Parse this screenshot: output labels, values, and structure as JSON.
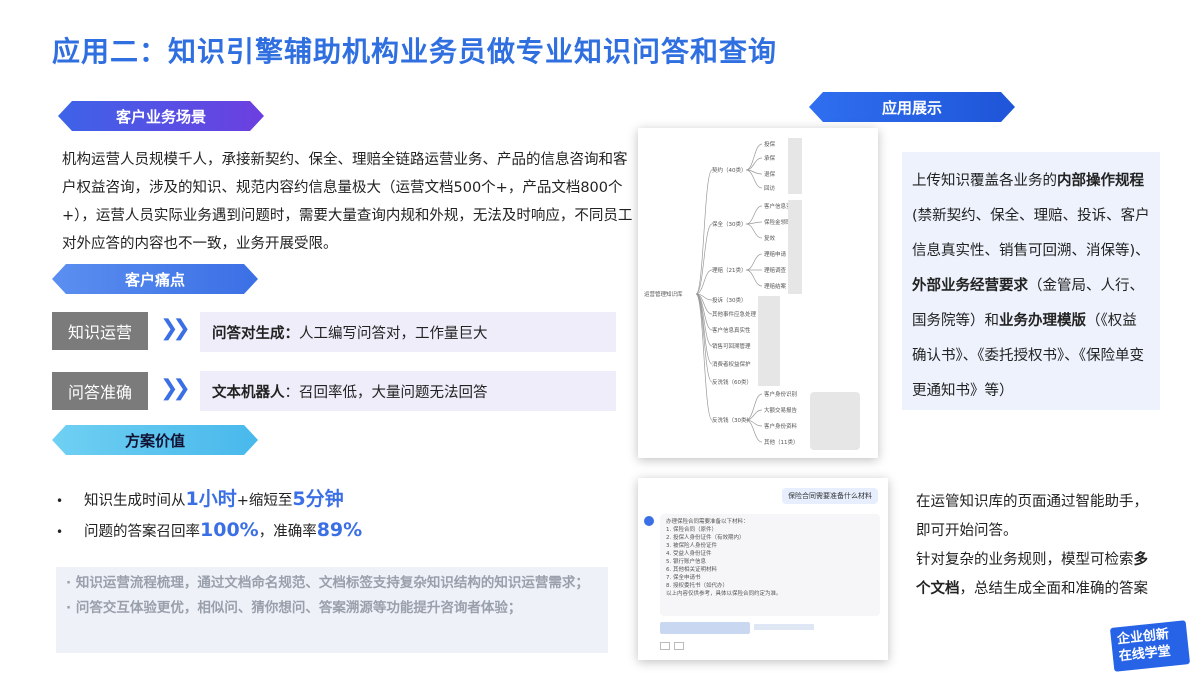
{
  "title": "应用二：知识引擎辅助机构业务员做专业知识问答和查询",
  "sections": {
    "scene": "客户业务场景",
    "pain": "客户痛点",
    "value": "方案价值",
    "show": "应用展示"
  },
  "scene_text": "机构运营人员规模千人，承接新契约、保全、理赔全链路运营业务、产品的信息咨询和客户权益咨询，涉及的知识、规范内容约信息量极大（运营文档500个+，产品文档800个+），运营人员实际业务遇到问题时，需要大量查询内规和外规，无法及时响应，不同员工对外应答的内容也不一致，业务开展受限。",
  "pains": [
    {
      "tag": "知识运营",
      "bold": "问答对生成：",
      "text": "人工编写问答对，工作量巨大"
    },
    {
      "tag": "问答准确",
      "bold": "文本机器人",
      "text": "：召回率低，大量问题无法回答"
    }
  ],
  "values": {
    "line1": {
      "pre": "知识生成时间从",
      "a": "1小时",
      "mid": "+缩短至",
      "b": "5分钟"
    },
    "line2": {
      "pre": "问题的答案召回率",
      "a": "100%",
      "mid": "，准确率",
      "b": "89%"
    }
  },
  "notes": [
    "· 知识运营流程梳理，通过文档命名规范、文档标签支持复杂知识结构的知识运营需求；",
    "· 问答交互体验更优，相似问、猜你想问、答案溯源等功能提升咨询者体验；"
  ],
  "right1": {
    "p1": "上传知识覆盖各业务的",
    "b1": "内部操作规程",
    "p2": "(禁新契约、保全、理赔、投诉、客户信息真实性、销售可回溯、消保等)、",
    "b2": "外部业务经营要求",
    "p3": "（金管局、人行、国务院等）和",
    "b3": "业务办理模版",
    "p4": "（《权益确认书》、《委托授权书》、《保险单变更通知书》等）"
  },
  "right2": {
    "p1": "在运管知识库的页面通过智能助手，即可开始问答。",
    "p2": "针对复杂的业务规则，模型可检索",
    "b1": "多个文档",
    "p3": "，总结生成全面和准确的答案"
  },
  "mindmap": {
    "root": "运营管理知识库",
    "branches": [
      "契约（40类）",
      "保全（30类）",
      "理赔（21类）",
      "投诉（30类）",
      "其他事件应急处理",
      "客户信息真实性",
      "销售可回溯管理",
      "消费者权益保护",
      "反洗钱（60类）",
      "反洗钱（30类）"
    ],
    "leaves": [
      "投保",
      "承保",
      "退保",
      "回访",
      "客户信息变更",
      "保险金领取",
      "复效",
      "理赔申请",
      "理赔调查",
      "理赔结案",
      "客户身份识别",
      "大额交易报告",
      "客户身份资料",
      "其他（11类）"
    ]
  },
  "chat": {
    "question": "保险合同需要准备什么材料",
    "answer_head": "办理保险合同需要准备以下材料：",
    "lines": [
      "1. 保险合同（原件）",
      "2. 投保人身份证件（有效期内）",
      "3. 被保险人身份证件",
      "4. 受益人身份证件",
      "5. 银行账户信息",
      "6. 其他相关证明材料",
      "7. 保全申请书",
      "8. 授权委托书（如代办）"
    ],
    "footer": "以上内容仅供参考，具体以保险合同约定为准。"
  },
  "logo": {
    "l1": "企业创新",
    "l2": "在线学堂"
  }
}
